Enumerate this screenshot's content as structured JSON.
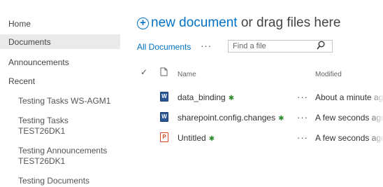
{
  "nav": {
    "home": "Home",
    "documents": "Documents",
    "announcements": "Announcements",
    "recent": "Recent",
    "recent_items": [
      "Testing Tasks WS-AGM1",
      "Testing Tasks",
      "TEST26DK1",
      "Testing Announcements",
      "TEST26DK1",
      "Testing Documents"
    ]
  },
  "header": {
    "new_document": "new document",
    "drag_text": " or drag files here",
    "view_label": "All Documents",
    "more_label": "···",
    "search_placeholder": "Find a file"
  },
  "table": {
    "checkmark": "✓",
    "col_name": "Name",
    "col_modified": "Modified",
    "rows": [
      {
        "name": "data_binding",
        "new_marker": "✱",
        "more": "···",
        "modified": "About a minute ago",
        "icon": "word-document-icon"
      },
      {
        "name": "sharepoint.config.changes",
        "new_marker": "✱",
        "more": "···",
        "modified": "A few seconds ago",
        "icon": "word-document-icon"
      },
      {
        "name": "Untitled",
        "new_marker": "✱",
        "more": "···",
        "modified": "A few seconds ago",
        "icon": "powerpoint-document-icon"
      }
    ]
  },
  "colors": {
    "accent": "#0072c6",
    "new_marker": "#2e8b2e",
    "nav_selected_bg": "#eaeaea"
  }
}
